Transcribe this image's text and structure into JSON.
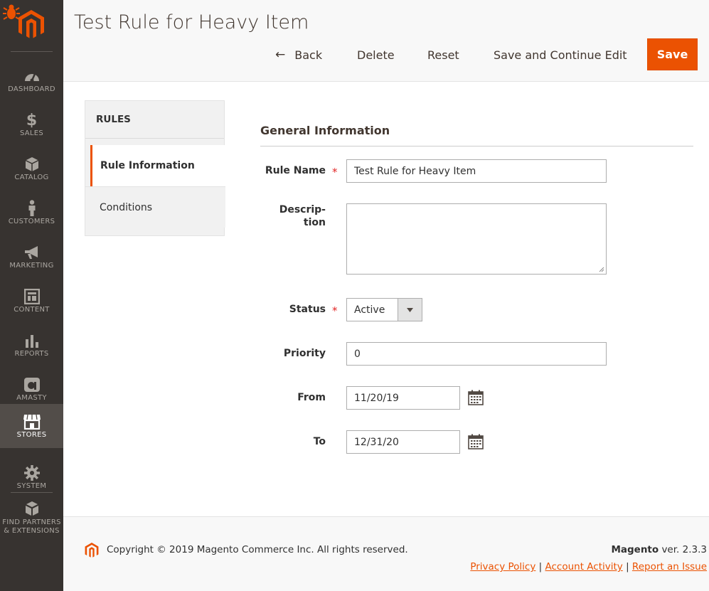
{
  "sidebar": {
    "items": [
      {
        "label": "Dashboard",
        "icon": "dashboard-icon"
      },
      {
        "label": "Sales",
        "icon": "dollar-icon"
      },
      {
        "label": "Catalog",
        "icon": "box-icon"
      },
      {
        "label": "Customers",
        "icon": "person-icon"
      },
      {
        "label": "Marketing",
        "icon": "megaphone-icon"
      },
      {
        "label": "Content",
        "icon": "layout-icon"
      },
      {
        "label": "Reports",
        "icon": "bar-chart-icon"
      },
      {
        "label": "Amasty",
        "icon": "amasty-icon"
      },
      {
        "label": "Stores",
        "icon": "store-icon",
        "active": true
      },
      {
        "label": "System",
        "icon": "gear-icon"
      },
      {
        "label": "Find Partners & Extensions",
        "icon": "cubes-icon"
      }
    ]
  },
  "header": {
    "title": "Test Rule for Heavy Item",
    "actions": {
      "back": "Back",
      "delete": "Delete",
      "reset": "Reset",
      "save_continue": "Save and Continue Edit",
      "save": "Save"
    }
  },
  "tabs": {
    "title": "RULES",
    "items": [
      {
        "label": "Rule Information",
        "active": true
      },
      {
        "label": "Conditions",
        "active": false
      }
    ]
  },
  "form": {
    "section_title": "General Information",
    "fields": {
      "rule_name": {
        "label": "Rule Name",
        "value": "Test Rule for Heavy Item",
        "required": true
      },
      "description": {
        "label_line1": "Descrip-",
        "label_line2": "tion",
        "value": ""
      },
      "status": {
        "label": "Status",
        "value": "Active",
        "required": true
      },
      "priority": {
        "label": "Priority",
        "value": "0"
      },
      "from": {
        "label": "From",
        "value": "11/20/19"
      },
      "to": {
        "label": "To",
        "value": "12/31/20"
      }
    }
  },
  "footer": {
    "copyright": "Copyright © 2019 Magento Commerce Inc. All rights reserved.",
    "brand": "Magento",
    "version": " ver. 2.3.3",
    "links": {
      "privacy": "Privacy Policy",
      "account_activity": "Account Activity",
      "report_issue": "Report an Issue"
    }
  },
  "colors": {
    "accent": "#eb5202",
    "sidebar_bg": "#373330",
    "required": "#e22626"
  }
}
